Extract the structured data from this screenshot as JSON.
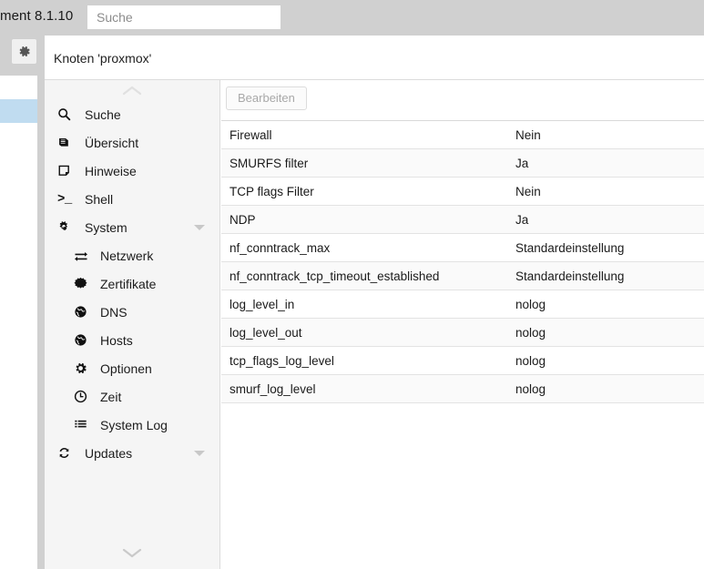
{
  "header": {
    "product_version": "ment 8.1.10",
    "search_placeholder": "Suche",
    "search_value": "",
    "gear_icon": "gear-icon"
  },
  "content_header": {
    "node_title": "Knoten 'proxmox'"
  },
  "sidebar": {
    "scroll_up_icon": "chevron-up-icon",
    "scroll_down_icon": "chevron-down-icon",
    "items": [
      {
        "label": "Suche",
        "icon": "search-icon",
        "level": 0,
        "expandable": false
      },
      {
        "label": "Übersicht",
        "icon": "book-icon",
        "level": 0,
        "expandable": false
      },
      {
        "label": "Hinweise",
        "icon": "note-icon",
        "level": 0,
        "expandable": false
      },
      {
        "label": "Shell",
        "icon": "terminal-icon",
        "level": 0,
        "expandable": false
      },
      {
        "label": "System",
        "icon": "cogs-icon",
        "level": 0,
        "expandable": true
      },
      {
        "label": "Netzwerk",
        "icon": "exchange-icon",
        "level": 1,
        "expandable": false
      },
      {
        "label": "Zertifikate",
        "icon": "certificate-icon",
        "level": 1,
        "expandable": false
      },
      {
        "label": "DNS",
        "icon": "globe-icon",
        "level": 1,
        "expandable": false
      },
      {
        "label": "Hosts",
        "icon": "globe-icon",
        "level": 1,
        "expandable": false
      },
      {
        "label": "Optionen",
        "icon": "gear-icon",
        "level": 1,
        "expandable": false
      },
      {
        "label": "Zeit",
        "icon": "clock-icon",
        "level": 1,
        "expandable": false
      },
      {
        "label": "System Log",
        "icon": "list-icon",
        "level": 1,
        "expandable": false
      },
      {
        "label": "Updates",
        "icon": "refresh-icon",
        "level": 0,
        "expandable": true
      }
    ]
  },
  "main": {
    "toolbar": {
      "edit_label": "Bearbeiten",
      "edit_disabled": true
    },
    "rows": [
      {
        "key": "Firewall",
        "value": "Nein"
      },
      {
        "key": "SMURFS filter",
        "value": "Ja"
      },
      {
        "key": "TCP flags Filter",
        "value": "Nein"
      },
      {
        "key": "NDP",
        "value": "Ja"
      },
      {
        "key": "nf_conntrack_max",
        "value": "Standardeinstellung"
      },
      {
        "key": "nf_conntrack_tcp_timeout_established",
        "value": "Standardeinstellung"
      },
      {
        "key": "log_level_in",
        "value": "nolog"
      },
      {
        "key": "log_level_out",
        "value": "nolog"
      },
      {
        "key": "tcp_flags_log_level",
        "value": "nolog"
      },
      {
        "key": "smurf_log_level",
        "value": "nolog"
      }
    ]
  },
  "tree_panel": {
    "selected_row_color": "#c0dcf0"
  },
  "colors": {
    "topbar_bg": "#d0d0d0",
    "sidebar_bg": "#f5f5f5",
    "row_alt_bg": "#fafafa",
    "border": "#e3e3e3"
  }
}
